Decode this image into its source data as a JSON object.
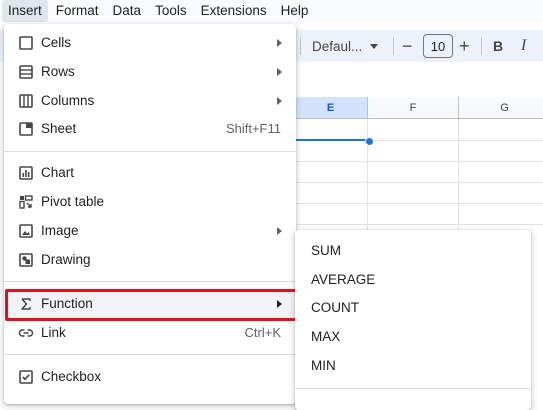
{
  "menubar": {
    "items": [
      "Insert",
      "Format",
      "Data",
      "Tools",
      "Extensions",
      "Help"
    ]
  },
  "toolbar": {
    "font_name": "Defaul...",
    "font_size": "10",
    "decrease_label": "−",
    "increase_label": "+",
    "bold_label": "B",
    "italic_label": "I"
  },
  "grid": {
    "columns": [
      "E",
      "F",
      "G"
    ],
    "selected_column": "E"
  },
  "insert_menu": {
    "items": [
      {
        "label": "Cells",
        "icon": "cells-icon",
        "submenu": true
      },
      {
        "label": "Rows",
        "icon": "rows-icon",
        "submenu": true
      },
      {
        "label": "Columns",
        "icon": "columns-icon",
        "submenu": true
      },
      {
        "label": "Sheet",
        "icon": "sheet-icon",
        "shortcut": "Shift+F11"
      },
      {
        "label": "Chart",
        "icon": "chart-icon"
      },
      {
        "label": "Pivot table",
        "icon": "pivot-table-icon"
      },
      {
        "label": "Image",
        "icon": "image-icon",
        "submenu": true
      },
      {
        "label": "Drawing",
        "icon": "drawing-icon"
      },
      {
        "label": "Function",
        "icon": "sigma-icon",
        "submenu": true,
        "highlighted": true
      },
      {
        "label": "Link",
        "icon": "link-icon",
        "shortcut": "Ctrl+K"
      },
      {
        "label": "Checkbox",
        "icon": "checkbox-icon"
      }
    ]
  },
  "function_submenu": {
    "items": [
      "SUM",
      "AVERAGE",
      "COUNT",
      "MAX",
      "MIN"
    ]
  },
  "colors": {
    "highlight_border": "#e0111b",
    "selection_blue": "#1a73e8",
    "toolbar_bg": "#edf2fa"
  }
}
